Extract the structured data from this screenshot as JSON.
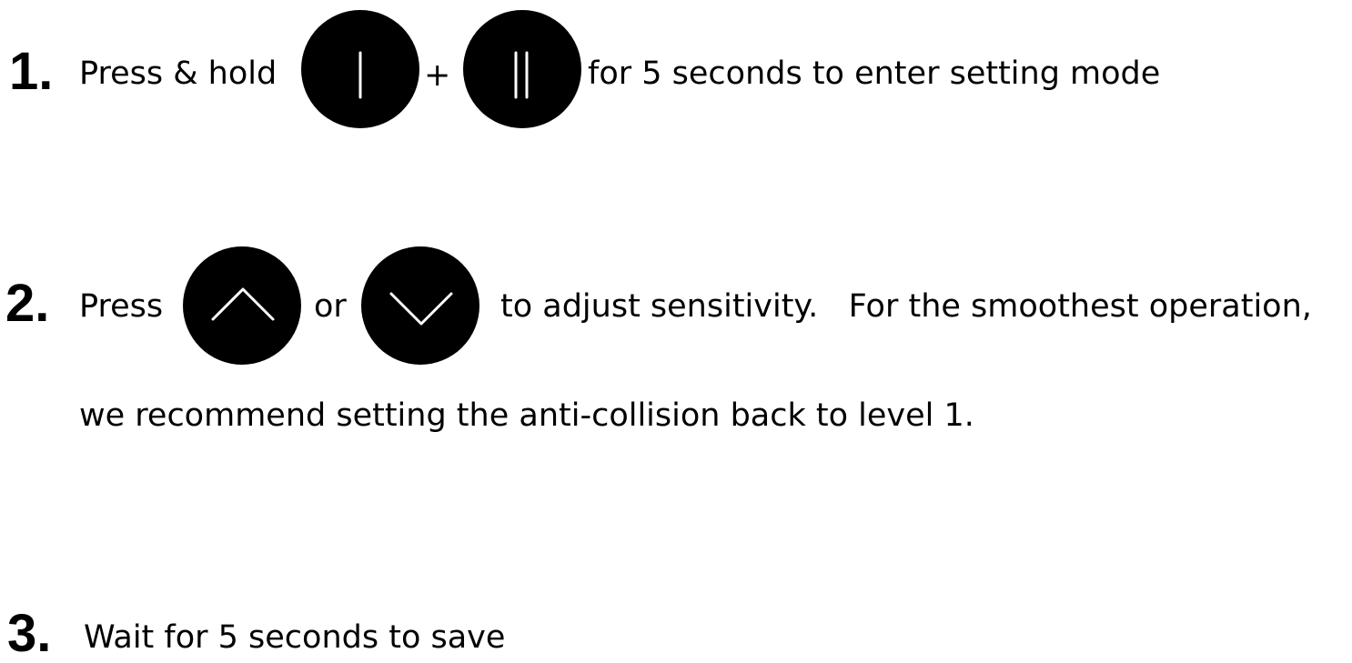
{
  "steps": [
    {
      "number": "1.",
      "text_before": "Press & hold",
      "plus": "+",
      "text_after": "for 5 seconds to enter setting mode",
      "buttons": [
        "position-1-icon",
        "position-2-icon"
      ]
    },
    {
      "number": "2.",
      "text_before": "Press",
      "or": "or",
      "text_after": "to adjust sensitivity.   For the smoothest operation,",
      "text_line2": "we recommend setting the anti-collision back to level 1.",
      "buttons": [
        "chevron-up-icon",
        "chevron-down-icon"
      ]
    },
    {
      "number": "3.",
      "text": "Wait for 5 seconds to save"
    }
  ],
  "colors": {
    "text": "#000000",
    "button_fill": "#000000",
    "button_glyph": "#ffffff",
    "background": "#ffffff"
  }
}
